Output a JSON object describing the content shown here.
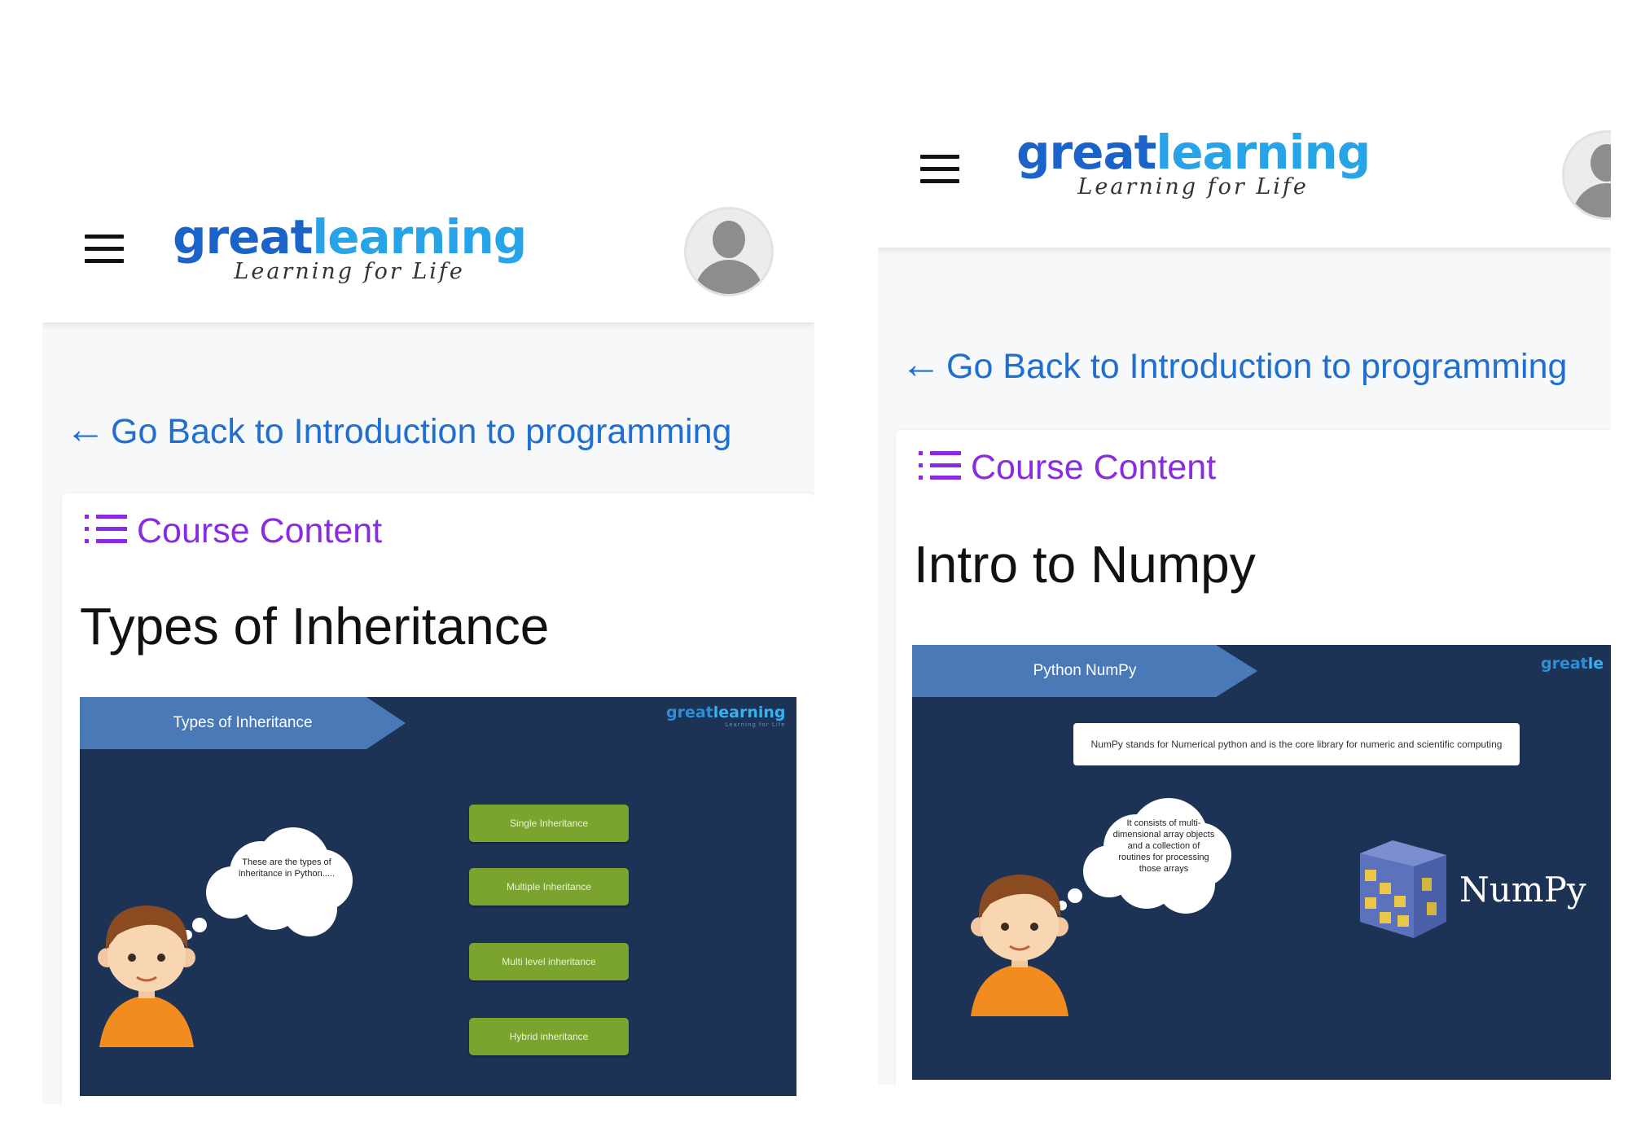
{
  "left": {
    "header": {
      "brand_great": "great",
      "brand_learning": "learning",
      "tagline": "Learning for Life"
    },
    "back_link": "Go Back to Introduction to programming",
    "course_content": "Course Content",
    "lesson_title": "Types of Inheritance",
    "slide": {
      "banner": "Types of Inheritance",
      "logo_great": "great",
      "logo_learning": "learning",
      "logo_sub": "Learning for Life",
      "thought": "These are the types of inheritance in Python.....",
      "buttons": [
        "Single Inheritance",
        "Multiple Inheritance",
        "Multi level inheritance",
        "Hybrid inheritance"
      ]
    }
  },
  "right": {
    "header": {
      "brand_great": "great",
      "brand_learning": "learning",
      "tagline": "Learning for Life"
    },
    "back_link": "Go Back to Introduction to programming",
    "course_content": "Course Content",
    "lesson_title": "Intro to Numpy",
    "slide": {
      "banner": "Python NumPy",
      "logo_great": "great",
      "logo_learning": "le",
      "info": "NumPy stands for Numerical python and is the core library for numeric and scientific computing",
      "thought": "It consists of multi-dimensional array objects and a collection of routines for processing those arrays",
      "numpy_label": "NumPy"
    }
  },
  "colors": {
    "brand_blue": "#1b63c9",
    "brand_light_blue": "#27a3e8",
    "link_blue": "#1f6fd0",
    "purple": "#8a2be2",
    "slide_bg": "#1d3356",
    "green": "#7ba42f"
  },
  "icons": [
    "hamburger-menu-icon",
    "avatar-icon",
    "back-arrow-icon",
    "list-icon"
  ]
}
